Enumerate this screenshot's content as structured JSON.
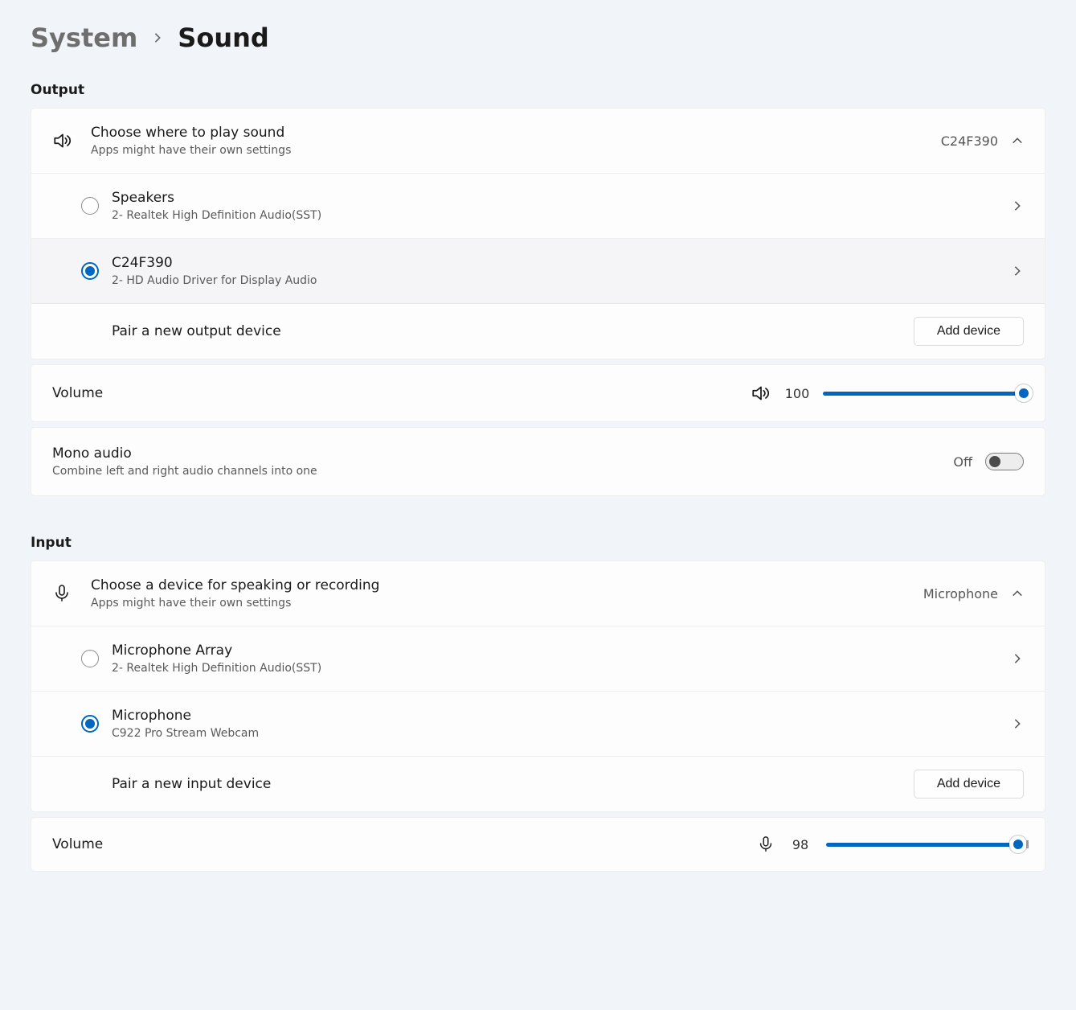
{
  "breadcrumb": {
    "parent": "System",
    "current": "Sound"
  },
  "output": {
    "heading": "Output",
    "choose": {
      "title": "Choose where to play sound",
      "sub": "Apps might have their own settings",
      "selected": "C24F390"
    },
    "devices": [
      {
        "name": "Speakers",
        "sub": "2- Realtek High Definition Audio(SST)",
        "checked": false
      },
      {
        "name": "C24F390",
        "sub": "2- HD Audio Driver for Display Audio",
        "checked": true
      }
    ],
    "pair": {
      "label": "Pair a new output device",
      "button": "Add device"
    },
    "volume": {
      "label": "Volume",
      "value": "100"
    },
    "mono": {
      "title": "Mono audio",
      "sub": "Combine left and right audio channels into one",
      "state": "Off"
    }
  },
  "input": {
    "heading": "Input",
    "choose": {
      "title": "Choose a device for speaking or recording",
      "sub": "Apps might have their own settings",
      "selected": "Microphone"
    },
    "devices": [
      {
        "name": "Microphone Array",
        "sub": "2- Realtek High Definition Audio(SST)",
        "checked": false
      },
      {
        "name": "Microphone",
        "sub": "C922 Pro Stream Webcam",
        "checked": true
      }
    ],
    "pair": {
      "label": "Pair a new input device",
      "button": "Add device"
    },
    "volume": {
      "label": "Volume",
      "value": "98"
    }
  }
}
